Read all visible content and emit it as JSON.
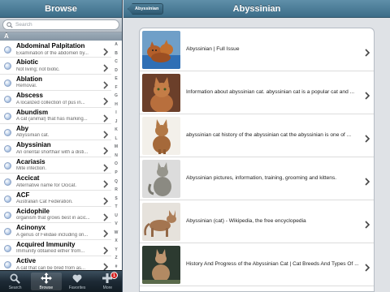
{
  "left": {
    "title": "Browse",
    "search_placeholder": "Search",
    "section_letter": "A",
    "terms": [
      {
        "name": "Abdominal Palpitation",
        "desc": "Examination of the abdomen by..."
      },
      {
        "name": "Abiotic",
        "desc": "Not living; not biotic."
      },
      {
        "name": "Ablation",
        "desc": "Removal."
      },
      {
        "name": "Abscess",
        "desc": "A localized collection of pus in..."
      },
      {
        "name": "Abundism",
        "desc": "A cat (animal) that has marking..."
      },
      {
        "name": "Aby",
        "desc": "Abyssinian cat."
      },
      {
        "name": "Abyssinian",
        "desc": "An oriental shorthair with a disti..."
      },
      {
        "name": "Acariasis",
        "desc": "Mite infection."
      },
      {
        "name": "Accicat",
        "desc": "Alternative name for Ocicat."
      },
      {
        "name": "ACF",
        "desc": "Australian Cat Federation."
      },
      {
        "name": "Acidophile",
        "desc": "organism that grows best in acic..."
      },
      {
        "name": "Acinonyx",
        "desc": "A genus of Felidae including on..."
      },
      {
        "name": "Acquired Immunity",
        "desc": "Immunity obtained either from..."
      },
      {
        "name": "Active",
        "desc": "A cat that can be bred from as..."
      }
    ],
    "index_letters": [
      "A",
      "B",
      "C",
      "D",
      "E",
      "F",
      "G",
      "H",
      "I",
      "J",
      "K",
      "L",
      "M",
      "N",
      "O",
      "P",
      "Q",
      "R",
      "S",
      "T",
      "U",
      "V",
      "W",
      "X",
      "Y",
      "Z",
      "#"
    ]
  },
  "tabs": [
    {
      "label": "Search",
      "icon": "magnifier-icon"
    },
    {
      "label": "Browse",
      "icon": "move-arrows-icon"
    },
    {
      "label": "Favorites",
      "icon": "heart-icon"
    },
    {
      "label": "More",
      "icon": "plus-icon",
      "badge": "1"
    }
  ],
  "detail": {
    "back_label": "Abyssinian",
    "title": "Abyssinian",
    "results": [
      {
        "text": "Abyssinian | Full Issue",
        "thumb": "kittens-in-blue-basket"
      },
      {
        "text": "Information about abyssinian cat. abyssinian cat is a popular cat and ...",
        "thumb": "ruddy-cat-portrait"
      },
      {
        "text": "abyssinian cat history of the abyssinian cat the abyssinian is one of ...",
        "thumb": "cat-on-white"
      },
      {
        "text": "Abyssinian pictures, information, training, grooming and kittens.",
        "thumb": "grey-cat-sitting"
      },
      {
        "text": "Abyssinian (cat) - Wikipedia, the free encyclopedia",
        "thumb": "cat-standing"
      },
      {
        "text": "History And Progress of the Abyssinian Cat | Cat Breeds And Types Of ...",
        "thumb": "cat-sitting-dark"
      }
    ]
  },
  "colors": {
    "header_top": "#5f8fa9",
    "header_bottom": "#3c6d88",
    "badge": "#d21f1f"
  }
}
